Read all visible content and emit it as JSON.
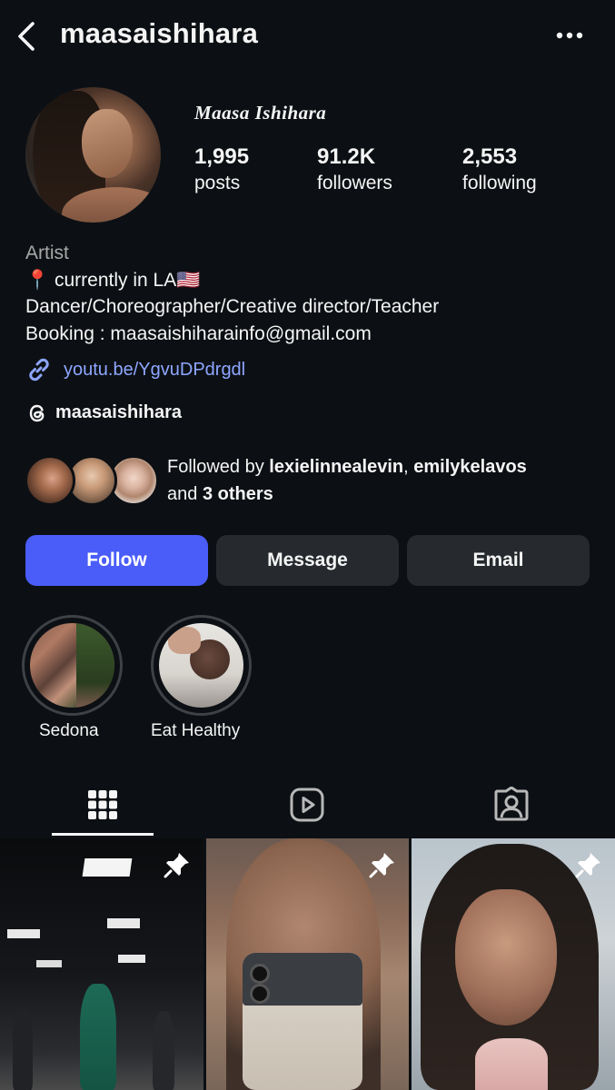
{
  "header": {
    "username": "maasaishihara",
    "back_icon": "chevron-left-icon",
    "more_icon": "more-horizontal-icon"
  },
  "profile": {
    "display_name": "Maasa Ishihara",
    "stats": [
      {
        "value": "1,995",
        "label": "posts"
      },
      {
        "value": "91.2K",
        "label": "followers"
      },
      {
        "value": "2,553",
        "label": "following"
      }
    ]
  },
  "bio": {
    "category": "Artist",
    "lines": [
      "📍 currently in LA🇺🇸",
      "Dancer/Choreographer/Creative director/Teacher",
      "Booking : maasaishiharainfo@gmail.com"
    ],
    "link": "youtu.be/YgvuDPdrgdl",
    "threads_handle": "maasaishihara"
  },
  "followed_by": {
    "prefix": "Followed by ",
    "user1": "lexielinnealevin",
    "separator": ", ",
    "user2": "emilykelavos",
    "and_text": "and ",
    "others": "3 others"
  },
  "actions": {
    "follow": "Follow",
    "message": "Message",
    "email": "Email"
  },
  "highlights": [
    {
      "label": "Sedona"
    },
    {
      "label": "Eat Healthy"
    }
  ],
  "tabs": [
    {
      "icon": "grid-icon",
      "active": true
    },
    {
      "icon": "reels-icon",
      "active": false
    },
    {
      "icon": "tagged-icon",
      "active": false
    }
  ],
  "colors": {
    "background": "#0c1014",
    "follow_button": "#4a5df9",
    "secondary_button": "#262a2f",
    "link": "#8ea6ff",
    "muted_text": "#a8a8a8"
  }
}
